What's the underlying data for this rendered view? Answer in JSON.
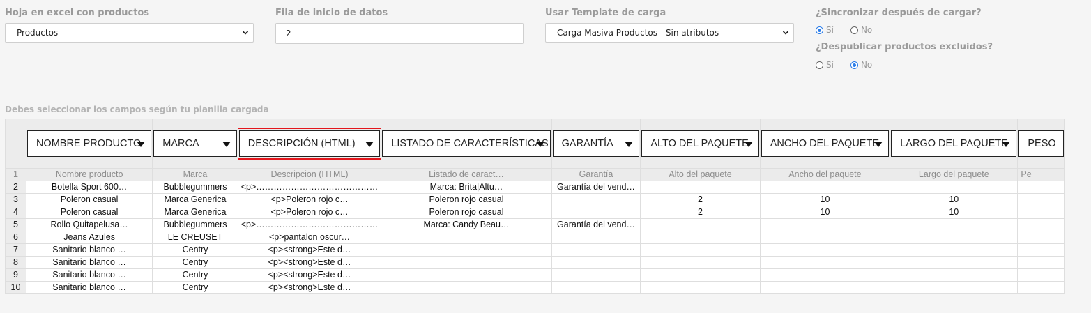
{
  "form": {
    "sheet": {
      "label": "Hoja en excel con productos",
      "value": "Productos"
    },
    "start_row": {
      "label": "Fila de inicio de datos",
      "value": "2"
    },
    "template": {
      "label": "Usar Template de carga",
      "value": "Carga Masiva Productos - Sin atributos"
    },
    "sync": {
      "label": "¿Sincronizar después de cargar?",
      "yes": "Sí",
      "no": "No",
      "selected": "yes"
    },
    "unpublish": {
      "label": "¿Despublicar productos excluidos?",
      "yes": "Sí",
      "no": "No",
      "selected": "no"
    }
  },
  "mapping": {
    "instruction": "Debes seleccionar los campos según tu planilla cargada",
    "selects": [
      "NOMBRE PRODUCTO",
      "MARCA",
      "DESCRIPCIÓN (HTML)",
      "LISTADO DE CARACTERÍSTICAS",
      "GARANTÍA",
      "ALTO DEL PAQUETE",
      "ANCHO DEL PAQUETE",
      "LARGO DEL PAQUETE",
      "PESO"
    ],
    "highlighted_column": 2,
    "header_row_number": "1",
    "column_names": [
      "Nombre producto",
      "Marca",
      "Descripcion (HTML)",
      "Listado de caract…",
      "Garantía",
      "Alto del paquete",
      "Ancho del paquete",
      "Largo del paquete",
      "Pe"
    ],
    "rows": [
      {
        "num": "2",
        "cells": [
          "Botella Sport 600…",
          "Bubblegummers",
          "<p>……………………………………",
          "Marca: Brita|Altu…",
          "Garantía del vend…",
          "",
          "",
          "",
          ""
        ]
      },
      {
        "num": "3",
        "cells": [
          "Poleron casual",
          "Marca Generica",
          "<p>Poleron rojo c…",
          "Poleron rojo casual",
          "",
          "2",
          "10",
          "10",
          ""
        ]
      },
      {
        "num": "4",
        "cells": [
          "Poleron casual",
          "Marca Generica",
          "<p>Poleron rojo c…",
          "Poleron rojo casual",
          "",
          "2",
          "10",
          "10",
          ""
        ]
      },
      {
        "num": "5",
        "cells": [
          "Rollo Quitapelusa…",
          "Bubblegummers",
          "<p>……………………………………",
          "Marca: Candy Beau…",
          "Garantía del vend…",
          "",
          "",
          "",
          ""
        ]
      },
      {
        "num": "6",
        "cells": [
          "Jeans Azules",
          "LE CREUSET",
          "<p>pantalon oscur…",
          "",
          "",
          "",
          "",
          "",
          ""
        ]
      },
      {
        "num": "7",
        "cells": [
          "Sanitario blanco …",
          "Centry",
          "<p><strong>Este d…",
          "",
          "",
          "",
          "",
          "",
          ""
        ]
      },
      {
        "num": "8",
        "cells": [
          "Sanitario blanco …",
          "Centry",
          "<p><strong>Este d…",
          "",
          "",
          "",
          "",
          "",
          ""
        ]
      },
      {
        "num": "9",
        "cells": [
          "Sanitario blanco …",
          "Centry",
          "<p><strong>Este d…",
          "",
          "",
          "",
          "",
          "",
          ""
        ]
      },
      {
        "num": "10",
        "cells": [
          "Sanitario blanco …",
          "Centry",
          "<p><strong>Este d…",
          "",
          "",
          "",
          "",
          "",
          ""
        ]
      }
    ]
  },
  "colors": {
    "accent": "#2b7de9",
    "highlight_border": "#e3161c"
  },
  "icons": {
    "select_chevron": "chevron-down-icon",
    "column_dropdown": "caret-down-icon",
    "radio": "radio-icon"
  }
}
